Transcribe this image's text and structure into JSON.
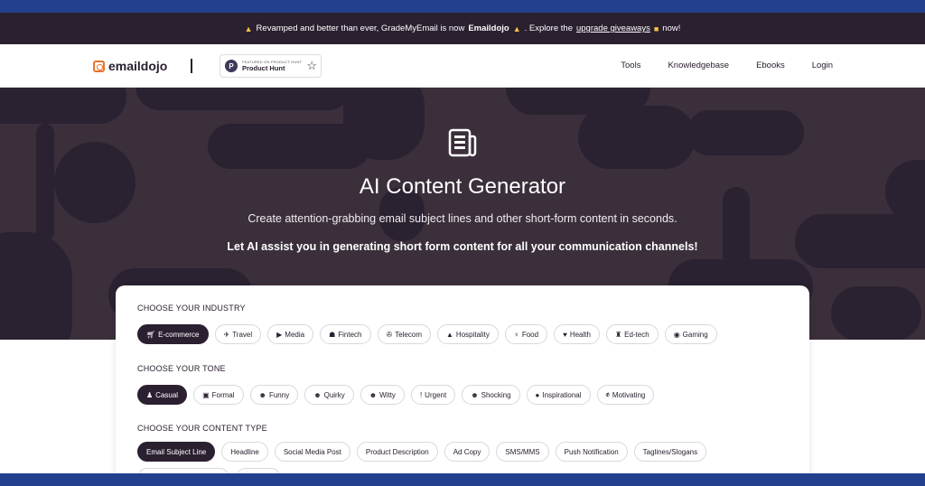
{
  "announcement": {
    "prefix": "Revamped and better than ever, GradeMyEmail is now",
    "brand": "Emaildojo",
    "middle": ". Explore the",
    "link": "upgrade giveaways",
    "suffix": "now!"
  },
  "nav": {
    "logo_text": "emaildojo",
    "ph_small": "FEATURED ON PRODUCT HUNT",
    "ph_big": "Product Hunt",
    "links": [
      "Tools",
      "Knowledgebase",
      "Ebooks",
      "Login"
    ]
  },
  "hero": {
    "title": "AI Content Generator",
    "subtitle": "Create attention-grabbing email subject lines and other short-form content in seconds.",
    "tagline": "Let AI assist you in generating short form content for all your communication channels!"
  },
  "industry": {
    "label": "CHOOSE YOUR INDUSTRY",
    "options": [
      "E-commerce",
      "Travel",
      "Media",
      "Fintech",
      "Telecom",
      "Hospitality",
      "Food",
      "Health",
      "Ed-tech",
      "Gaming"
    ],
    "selected": "E-commerce"
  },
  "tone": {
    "label": "CHOOSE YOUR TONE",
    "options": [
      "Casual",
      "Formal",
      "Funny",
      "Quirky",
      "Witty",
      "Urgent",
      "Shocking",
      "Inspirational",
      "Motivating"
    ],
    "selected": "Casual"
  },
  "content_type": {
    "label": "CHOOSE YOUR CONTENT TYPE",
    "options": [
      "Email Subject Line",
      "Headline",
      "Social Media Post",
      "Product Description",
      "Ad Copy",
      "SMS/MMS",
      "Push Notification",
      "Taglines/Slogans"
    ],
    "selected": "Email Subject Line"
  },
  "colors": {
    "frame": "#23408e",
    "dark": "#2b2030",
    "hero_bg": "#3a2f3b",
    "accent": "#e8732c"
  }
}
